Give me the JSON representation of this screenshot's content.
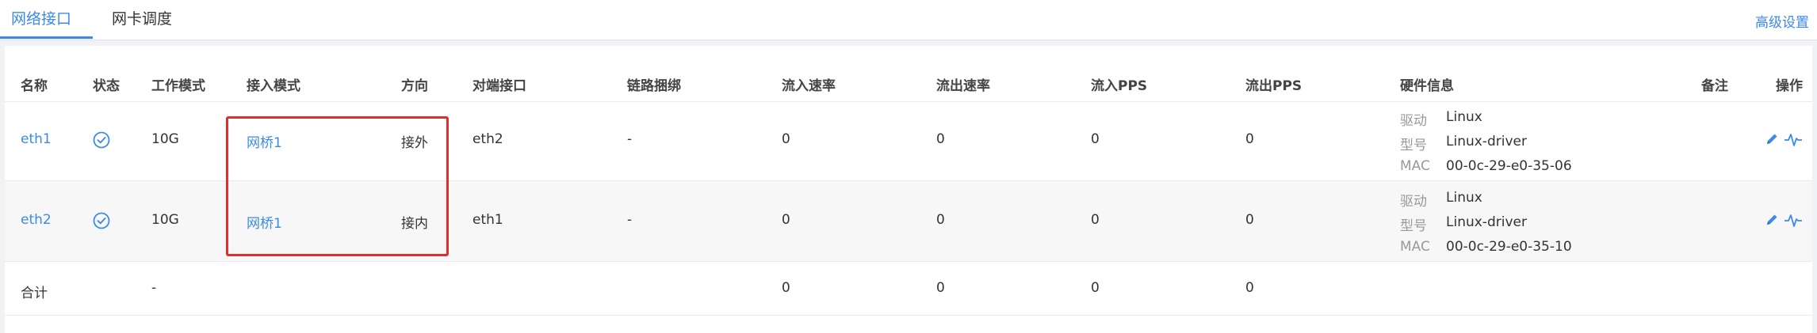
{
  "tabs": [
    {
      "label": "网络接口",
      "active": true
    },
    {
      "label": "网卡调度",
      "active": false
    }
  ],
  "advanced_link": "高级设置",
  "table": {
    "headers": {
      "name": "名称",
      "status": "状态",
      "work_mode": "工作模式",
      "access_mode": "接入模式",
      "direction": "方向",
      "peer": "对端接口",
      "link_bond": "链路捆绑",
      "in_rate": "流入速率",
      "out_rate": "流出速率",
      "in_pps": "流入PPS",
      "out_pps": "流出PPS",
      "hw_info": "硬件信息",
      "remark": "备注",
      "action": "操作"
    },
    "hw_labels": {
      "driver": "驱动",
      "model": "型号",
      "mac": "MAC"
    },
    "rows": [
      {
        "name": "eth1",
        "status": "enabled",
        "work_mode": "10G",
        "access_mode": "网桥1",
        "direction": "接外",
        "peer": "eth2",
        "link_bond": "-",
        "in_rate": "0",
        "out_rate": "0",
        "in_pps": "0",
        "out_pps": "0",
        "hw": {
          "driver": "Linux",
          "model": "Linux-driver",
          "mac": "00-0c-29-e0-35-06"
        },
        "remark": ""
      },
      {
        "name": "eth2",
        "status": "enabled",
        "work_mode": "10G",
        "access_mode": "网桥1",
        "direction": "接内",
        "peer": "eth1",
        "link_bond": "-",
        "in_rate": "0",
        "out_rate": "0",
        "in_pps": "0",
        "out_pps": "0",
        "hw": {
          "driver": "Linux",
          "model": "Linux-driver",
          "mac": "00-0c-29-e0-35-10"
        },
        "remark": ""
      }
    ],
    "total": {
      "label": "合计",
      "work_mode": "-",
      "in_rate": "0",
      "out_rate": "0",
      "in_pps": "0",
      "out_pps": "0"
    }
  },
  "colors": {
    "accent": "#3b8ae8",
    "highlight": "#e62b2b",
    "alt_row": "#f7f7f7",
    "page_bg": "#f0f2f5"
  },
  "icons": {
    "status": "check-circle-icon",
    "edit": "pencil-icon",
    "monitor": "pulse-icon"
  }
}
